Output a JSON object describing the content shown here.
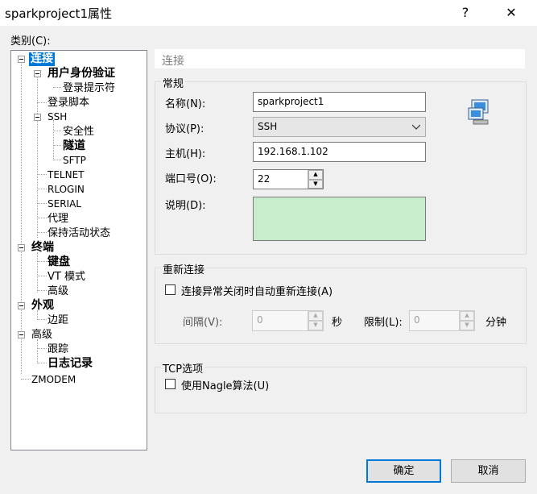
{
  "window": {
    "title": "sparkproject1属性",
    "help_icon": "?",
    "close_icon": "✕"
  },
  "category_label": "类别(C):",
  "tree": [
    {
      "label": "连接",
      "bold": true,
      "selected": true
    },
    {
      "label": "用户身份验证",
      "bold": true
    },
    {
      "label": "登录提示符"
    },
    {
      "label": "登录脚本"
    },
    {
      "label": "SSH"
    },
    {
      "label": "安全性"
    },
    {
      "label": "隧道",
      "bold": true
    },
    {
      "label": "SFTP"
    },
    {
      "label": "TELNET"
    },
    {
      "label": "RLOGIN"
    },
    {
      "label": "SERIAL"
    },
    {
      "label": "代理"
    },
    {
      "label": "保持活动状态"
    },
    {
      "label": "终端",
      "bold": true
    },
    {
      "label": "键盘",
      "bold": true
    },
    {
      "label": "VT 模式"
    },
    {
      "label": "高级"
    },
    {
      "label": "外观",
      "bold": true
    },
    {
      "label": "边距"
    },
    {
      "label": "高级"
    },
    {
      "label": "跟踪"
    },
    {
      "label": "日志记录",
      "bold": true
    },
    {
      "label": "ZMODEM"
    }
  ],
  "header": "连接",
  "general": {
    "group_label": "常规",
    "name_label": "名称(N):",
    "name_value": "sparkproject1",
    "protocol_label": "协议(P):",
    "protocol_value": "SSH",
    "host_label": "主机(H):",
    "host_value": "192.168.1.102",
    "port_label": "端口号(O):",
    "port_value": "22",
    "desc_label": "说明(D):",
    "desc_value": ""
  },
  "reconnect": {
    "group_label": "重新连接",
    "checkbox_label": "连接异常关闭时自动重新连接(A)",
    "interval_label": "间隔(V):",
    "interval_value": "0",
    "interval_unit": "秒",
    "limit_label": "限制(L):",
    "limit_value": "0",
    "limit_unit": "分钟"
  },
  "tcp": {
    "group_label": "TCP选项",
    "nagle_label": "使用Nagle算法(U)"
  },
  "buttons": {
    "ok": "确定",
    "cancel": "取消"
  },
  "colors": {
    "description_bg": "#c7edcc",
    "selection": "#0078d7"
  }
}
